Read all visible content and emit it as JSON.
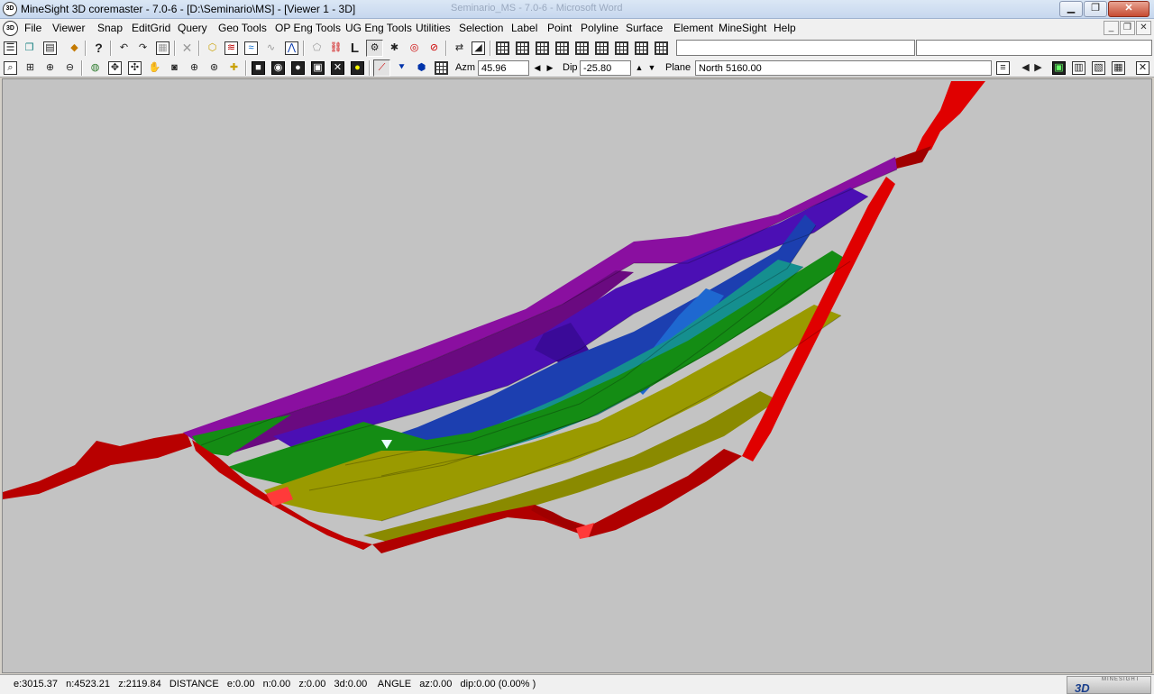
{
  "window": {
    "title": "MineSight 3D coremaster - 7.0-6  - [D:\\Seminario\\MS] - [Viewer 1 - 3D]",
    "background_title": "Seminario_MS - 7.0-6 - Microsoft Word",
    "app_icon_text": "3D"
  },
  "menu": {
    "items": [
      "File",
      "Viewer",
      "Snap",
      "EditGrid",
      "Query",
      "Geo Tools",
      "OP Eng Tools",
      "UG Eng Tools",
      "Utilities",
      "Selection",
      "Label",
      "Point",
      "Polyline",
      "Surface",
      "Element",
      "MineSight",
      "Help"
    ]
  },
  "toolbar2": {
    "azm_label": "Azm",
    "azm_value": "45.96",
    "dip_label": "Dip",
    "dip_value": "-25.80",
    "plane_label": "Plane",
    "plane_value": "North 5160.00"
  },
  "statusbar": {
    "text": "e:3015.37   n:4523.21   z:2119.84   DISTANCE   e:0.00   n:0.00   z:0.00   3d:0.00    ANGLE   az:0.00   dip:0.00 (0.00% )"
  },
  "logo": {
    "small_text": "MINESIGHT",
    "big_text": "3D"
  },
  "colors": {
    "viewport_bg": "#c3c3c3",
    "pit_bench_colors": [
      "#cc0000",
      "#9a9a00",
      "#148c14",
      "#158f8f",
      "#1c3fb0",
      "#4b0fb4",
      "#8a0fa0"
    ]
  }
}
